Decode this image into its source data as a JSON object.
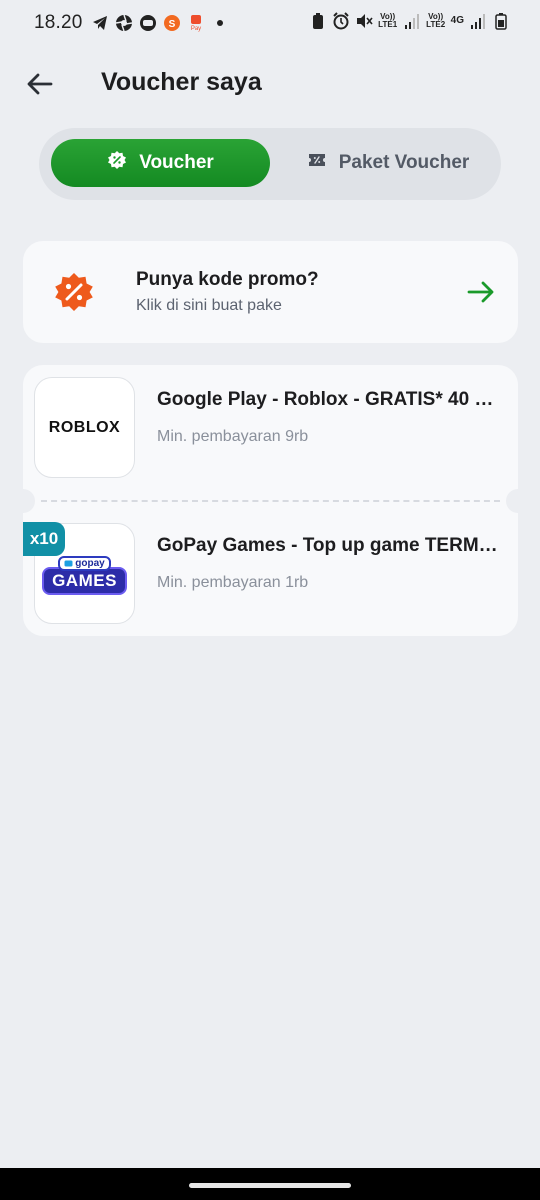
{
  "status_bar": {
    "time": "18.20",
    "sim1_label": "Vo)) LTE1",
    "sim2_label": "Vo)) LTE2",
    "network_type": "4G"
  },
  "header": {
    "title": "Voucher saya"
  },
  "tabs": [
    {
      "label": "Voucher",
      "active": true
    },
    {
      "label": "Paket Voucher",
      "active": false
    }
  ],
  "promo": {
    "title": "Punya kode promo?",
    "subtitle": "Klik di sini buat pake"
  },
  "vouchers": [
    {
      "title": "Google Play - Roblox - GRATIS* 40 …",
      "min_payment": "Min. pembayaran 9rb",
      "logo_text": "ROBLOX"
    },
    {
      "title": "GoPay Games - Top up game TERM…",
      "min_payment": "Min. pembayaran 1rb",
      "logo_top": "gopay",
      "logo_bottom": "GAMES",
      "quantity": "x10"
    }
  ],
  "colors": {
    "accent_green": "#1a9a2a",
    "promo_orange": "#ee5a1c",
    "badge_teal": "#1190a6"
  }
}
